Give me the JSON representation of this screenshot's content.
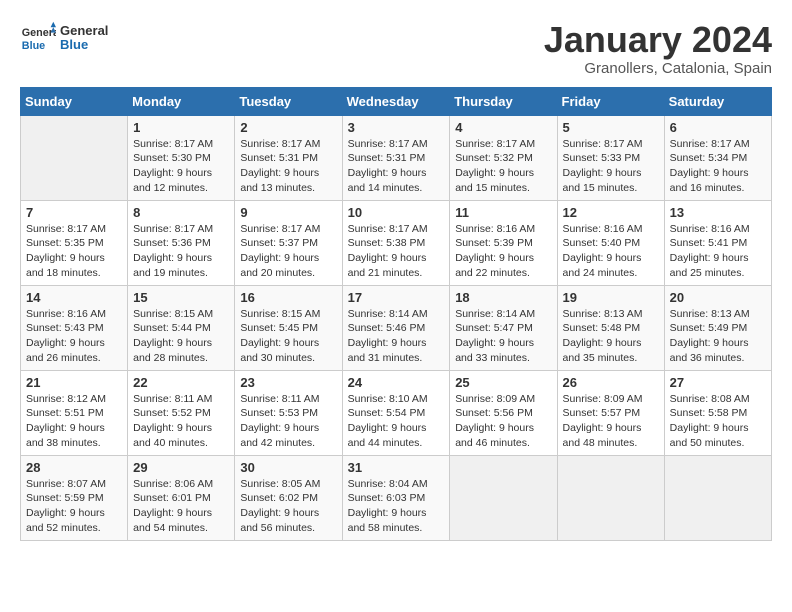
{
  "header": {
    "logo_general": "General",
    "logo_blue": "Blue",
    "month_title": "January 2024",
    "subtitle": "Granollers, Catalonia, Spain"
  },
  "weekdays": [
    "Sunday",
    "Monday",
    "Tuesday",
    "Wednesday",
    "Thursday",
    "Friday",
    "Saturday"
  ],
  "weeks": [
    [
      {
        "day": "",
        "sunrise": "",
        "sunset": "",
        "daylight": ""
      },
      {
        "day": "1",
        "sunrise": "Sunrise: 8:17 AM",
        "sunset": "Sunset: 5:30 PM",
        "daylight": "Daylight: 9 hours and 12 minutes."
      },
      {
        "day": "2",
        "sunrise": "Sunrise: 8:17 AM",
        "sunset": "Sunset: 5:31 PM",
        "daylight": "Daylight: 9 hours and 13 minutes."
      },
      {
        "day": "3",
        "sunrise": "Sunrise: 8:17 AM",
        "sunset": "Sunset: 5:31 PM",
        "daylight": "Daylight: 9 hours and 14 minutes."
      },
      {
        "day": "4",
        "sunrise": "Sunrise: 8:17 AM",
        "sunset": "Sunset: 5:32 PM",
        "daylight": "Daylight: 9 hours and 15 minutes."
      },
      {
        "day": "5",
        "sunrise": "Sunrise: 8:17 AM",
        "sunset": "Sunset: 5:33 PM",
        "daylight": "Daylight: 9 hours and 15 minutes."
      },
      {
        "day": "6",
        "sunrise": "Sunrise: 8:17 AM",
        "sunset": "Sunset: 5:34 PM",
        "daylight": "Daylight: 9 hours and 16 minutes."
      }
    ],
    [
      {
        "day": "7",
        "sunrise": "Sunrise: 8:17 AM",
        "sunset": "Sunset: 5:35 PM",
        "daylight": "Daylight: 9 hours and 18 minutes."
      },
      {
        "day": "8",
        "sunrise": "Sunrise: 8:17 AM",
        "sunset": "Sunset: 5:36 PM",
        "daylight": "Daylight: 9 hours and 19 minutes."
      },
      {
        "day": "9",
        "sunrise": "Sunrise: 8:17 AM",
        "sunset": "Sunset: 5:37 PM",
        "daylight": "Daylight: 9 hours and 20 minutes."
      },
      {
        "day": "10",
        "sunrise": "Sunrise: 8:17 AM",
        "sunset": "Sunset: 5:38 PM",
        "daylight": "Daylight: 9 hours and 21 minutes."
      },
      {
        "day": "11",
        "sunrise": "Sunrise: 8:16 AM",
        "sunset": "Sunset: 5:39 PM",
        "daylight": "Daylight: 9 hours and 22 minutes."
      },
      {
        "day": "12",
        "sunrise": "Sunrise: 8:16 AM",
        "sunset": "Sunset: 5:40 PM",
        "daylight": "Daylight: 9 hours and 24 minutes."
      },
      {
        "day": "13",
        "sunrise": "Sunrise: 8:16 AM",
        "sunset": "Sunset: 5:41 PM",
        "daylight": "Daylight: 9 hours and 25 minutes."
      }
    ],
    [
      {
        "day": "14",
        "sunrise": "Sunrise: 8:16 AM",
        "sunset": "Sunset: 5:43 PM",
        "daylight": "Daylight: 9 hours and 26 minutes."
      },
      {
        "day": "15",
        "sunrise": "Sunrise: 8:15 AM",
        "sunset": "Sunset: 5:44 PM",
        "daylight": "Daylight: 9 hours and 28 minutes."
      },
      {
        "day": "16",
        "sunrise": "Sunrise: 8:15 AM",
        "sunset": "Sunset: 5:45 PM",
        "daylight": "Daylight: 9 hours and 30 minutes."
      },
      {
        "day": "17",
        "sunrise": "Sunrise: 8:14 AM",
        "sunset": "Sunset: 5:46 PM",
        "daylight": "Daylight: 9 hours and 31 minutes."
      },
      {
        "day": "18",
        "sunrise": "Sunrise: 8:14 AM",
        "sunset": "Sunset: 5:47 PM",
        "daylight": "Daylight: 9 hours and 33 minutes."
      },
      {
        "day": "19",
        "sunrise": "Sunrise: 8:13 AM",
        "sunset": "Sunset: 5:48 PM",
        "daylight": "Daylight: 9 hours and 35 minutes."
      },
      {
        "day": "20",
        "sunrise": "Sunrise: 8:13 AM",
        "sunset": "Sunset: 5:49 PM",
        "daylight": "Daylight: 9 hours and 36 minutes."
      }
    ],
    [
      {
        "day": "21",
        "sunrise": "Sunrise: 8:12 AM",
        "sunset": "Sunset: 5:51 PM",
        "daylight": "Daylight: 9 hours and 38 minutes."
      },
      {
        "day": "22",
        "sunrise": "Sunrise: 8:11 AM",
        "sunset": "Sunset: 5:52 PM",
        "daylight": "Daylight: 9 hours and 40 minutes."
      },
      {
        "day": "23",
        "sunrise": "Sunrise: 8:11 AM",
        "sunset": "Sunset: 5:53 PM",
        "daylight": "Daylight: 9 hours and 42 minutes."
      },
      {
        "day": "24",
        "sunrise": "Sunrise: 8:10 AM",
        "sunset": "Sunset: 5:54 PM",
        "daylight": "Daylight: 9 hours and 44 minutes."
      },
      {
        "day": "25",
        "sunrise": "Sunrise: 8:09 AM",
        "sunset": "Sunset: 5:56 PM",
        "daylight": "Daylight: 9 hours and 46 minutes."
      },
      {
        "day": "26",
        "sunrise": "Sunrise: 8:09 AM",
        "sunset": "Sunset: 5:57 PM",
        "daylight": "Daylight: 9 hours and 48 minutes."
      },
      {
        "day": "27",
        "sunrise": "Sunrise: 8:08 AM",
        "sunset": "Sunset: 5:58 PM",
        "daylight": "Daylight: 9 hours and 50 minutes."
      }
    ],
    [
      {
        "day": "28",
        "sunrise": "Sunrise: 8:07 AM",
        "sunset": "Sunset: 5:59 PM",
        "daylight": "Daylight: 9 hours and 52 minutes."
      },
      {
        "day": "29",
        "sunrise": "Sunrise: 8:06 AM",
        "sunset": "Sunset: 6:01 PM",
        "daylight": "Daylight: 9 hours and 54 minutes."
      },
      {
        "day": "30",
        "sunrise": "Sunrise: 8:05 AM",
        "sunset": "Sunset: 6:02 PM",
        "daylight": "Daylight: 9 hours and 56 minutes."
      },
      {
        "day": "31",
        "sunrise": "Sunrise: 8:04 AM",
        "sunset": "Sunset: 6:03 PM",
        "daylight": "Daylight: 9 hours and 58 minutes."
      },
      {
        "day": "",
        "sunrise": "",
        "sunset": "",
        "daylight": ""
      },
      {
        "day": "",
        "sunrise": "",
        "sunset": "",
        "daylight": ""
      },
      {
        "day": "",
        "sunrise": "",
        "sunset": "",
        "daylight": ""
      }
    ]
  ]
}
